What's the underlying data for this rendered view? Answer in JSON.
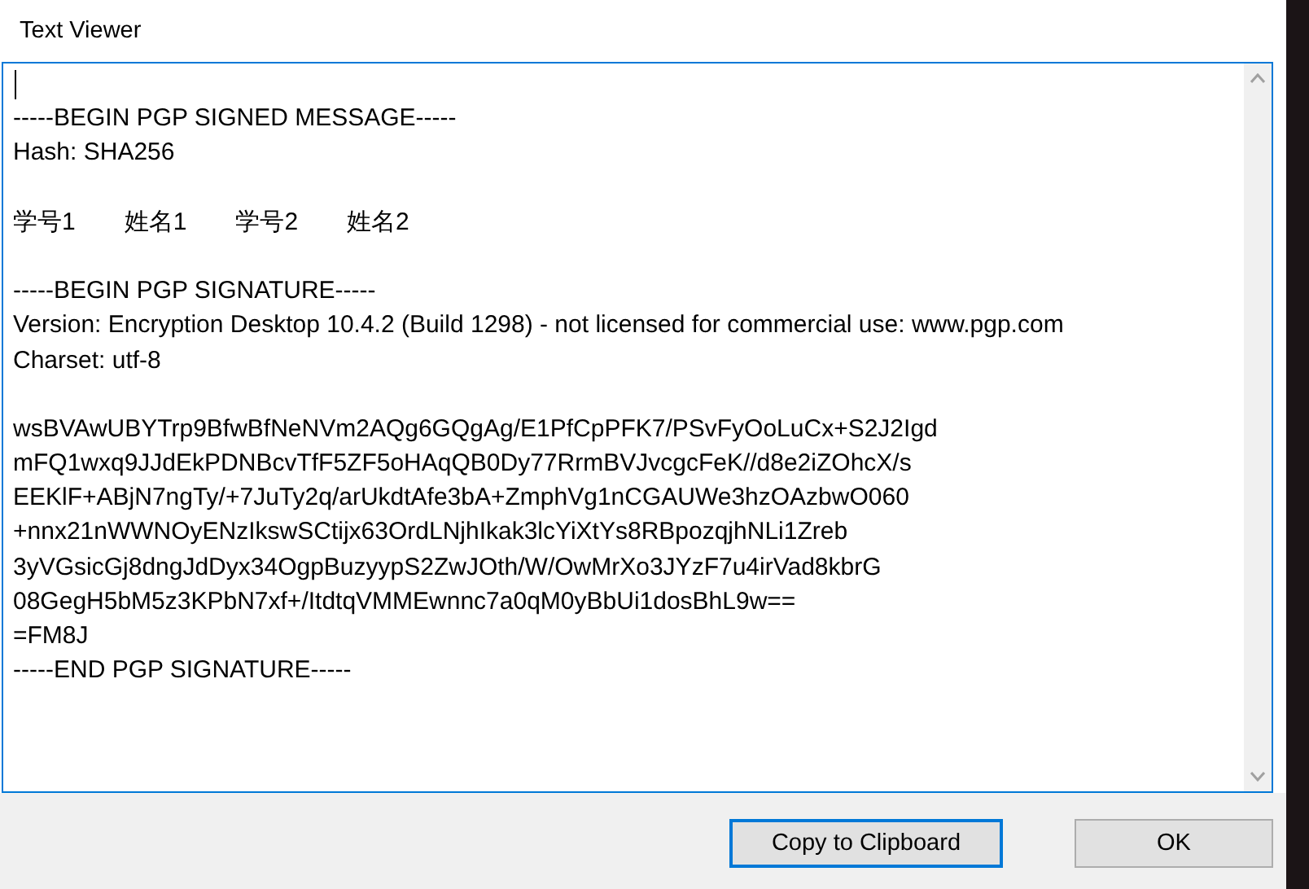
{
  "window": {
    "title": "Text Viewer"
  },
  "text_lines": [
    {
      "kind": "blank"
    },
    {
      "kind": "text",
      "text": "-----BEGIN PGP SIGNED MESSAGE-----"
    },
    {
      "kind": "text",
      "text": "Hash: SHA256"
    },
    {
      "kind": "blank"
    },
    {
      "kind": "cells",
      "cells": [
        "学号1",
        "姓名1",
        "学号2",
        "姓名2"
      ]
    },
    {
      "kind": "blank"
    },
    {
      "kind": "text",
      "text": "-----BEGIN PGP SIGNATURE-----"
    },
    {
      "kind": "text",
      "text": "Version: Encryption Desktop 10.4.2 (Build 1298) - not licensed for commercial use: www.pgp.com"
    },
    {
      "kind": "text",
      "text": "Charset: utf-8"
    },
    {
      "kind": "blank"
    },
    {
      "kind": "text",
      "text": "wsBVAwUBYTrp9BfwBfNeNVm2AQg6GQgAg/E1PfCpPFK7/PSvFyOoLuCx+S2J2Igd"
    },
    {
      "kind": "text",
      "text": "mFQ1wxq9JJdEkPDNBcvTfF5ZF5oHAqQB0Dy77RrmBVJvcgcFeK//d8e2iZOhcX/s"
    },
    {
      "kind": "text",
      "text": "EEKlF+ABjN7ngTy/+7JuTy2q/arUkdtAfe3bA+ZmphVg1nCGAUWe3hzOAzbwO060"
    },
    {
      "kind": "text",
      "text": "+nnx21nWWNOyENzIkswSCtijx63OrdLNjhIkak3lcYiXtYs8RBpozqjhNLi1Zreb"
    },
    {
      "kind": "text",
      "text": "3yVGsicGj8dngJdDyx34OgpBuzyypS2ZwJOth/W/OwMrXo3JYzF7u4irVad8kbrG"
    },
    {
      "kind": "text",
      "text": "08GegH5bM5z3KPbN7xf+/ItdtqVMMEwnnc7a0qM0yBbUi1dosBhL9w=="
    },
    {
      "kind": "text",
      "text": "=FM8J"
    },
    {
      "kind": "text",
      "text": "-----END PGP SIGNATURE-----"
    }
  ],
  "buttons": [
    {
      "label": "Copy to Clipboard",
      "selected": true
    },
    {
      "label": "OK",
      "selected": false
    }
  ]
}
